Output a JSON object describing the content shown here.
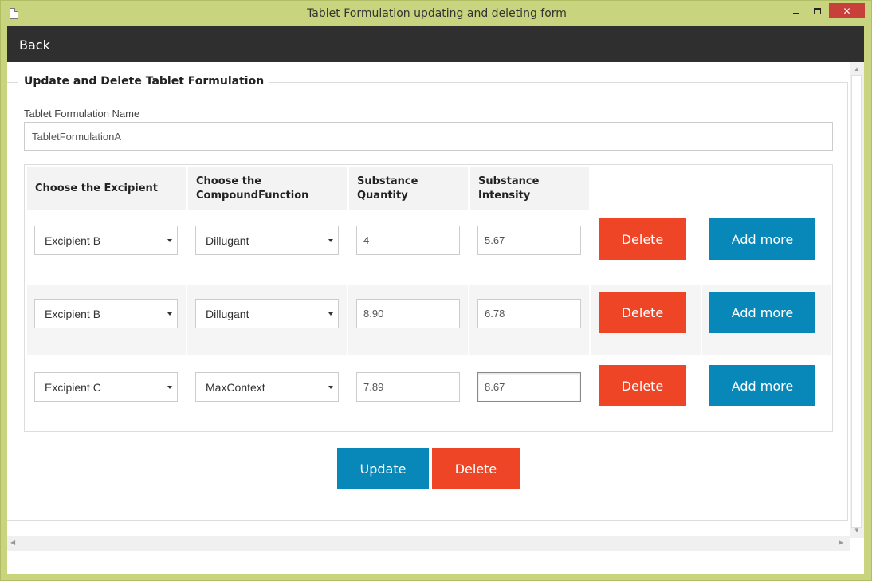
{
  "window": {
    "title": "Tablet Formulation updating and deleting form",
    "close_icon": "close-icon",
    "minimize_icon": "minimize-icon",
    "maximize_icon": "maximize-icon"
  },
  "navbar": {
    "back_label": "Back"
  },
  "form": {
    "legend": "Update and Delete Tablet Formulation",
    "name_label": "Tablet Formulation Name",
    "name_value": "TabletFormulationA"
  },
  "table": {
    "headers": [
      "Choose the Excipient",
      "Choose the CompoundFunction",
      "Substance Quantity",
      "Substance Intensity"
    ],
    "rows": [
      {
        "excipient": "Excipient B",
        "function": "Dillugant",
        "quantity": "4",
        "intensity": "5.67",
        "delete_label": "Delete",
        "add_label": "Add more"
      },
      {
        "excipient": "Excipient B",
        "function": "Dillugant",
        "quantity": "8.90",
        "intensity": "6.78",
        "delete_label": "Delete",
        "add_label": "Add more"
      },
      {
        "excipient": "Excipient C",
        "function": "MaxContext",
        "quantity": "7.89",
        "intensity": "8.67",
        "delete_label": "Delete",
        "add_label": "Add more"
      }
    ]
  },
  "actions": {
    "update_label": "Update",
    "delete_label": "Delete"
  },
  "colors": {
    "accent_blue": "#0788b8",
    "danger_red": "#ef4527",
    "navbar": "#2f2f2f",
    "window_frame": "#c9d57e"
  }
}
